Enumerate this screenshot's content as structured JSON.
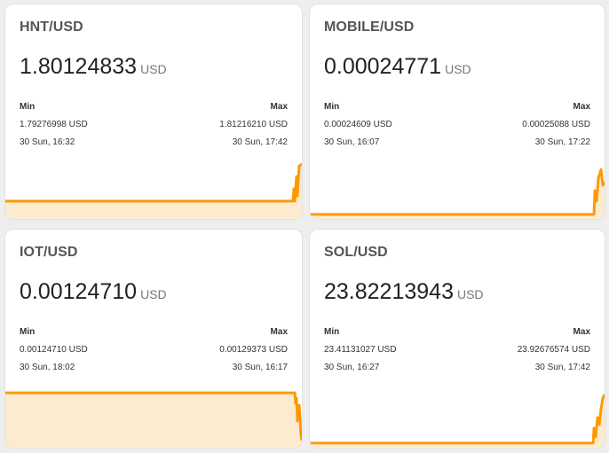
{
  "cards": [
    {
      "title": "HNT/USD",
      "value": "1.80124833",
      "unit": "USD",
      "min_label": "Min",
      "max_label": "Max",
      "min_value": "1.79276998 USD",
      "max_value": "1.81216210 USD",
      "min_time": "30 Sun, 16:32",
      "max_time": "30 Sun, 17:42"
    },
    {
      "title": "MOBILE/USD",
      "value": "0.00024771",
      "unit": "USD",
      "min_label": "Min",
      "max_label": "Max",
      "min_value": "0.00024609 USD",
      "max_value": "0.00025088 USD",
      "min_time": "30 Sun, 16:07",
      "max_time": "30 Sun, 17:22"
    },
    {
      "title": "IOT/USD",
      "value": "0.00124710",
      "unit": "USD",
      "min_label": "Min",
      "max_label": "Max",
      "min_value": "0.00124710 USD",
      "max_value": "0.00129373 USD",
      "min_time": "30 Sun, 18:02",
      "max_time": "30 Sun, 16:17"
    },
    {
      "title": "SOL/USD",
      "value": "23.82213943",
      "unit": "USD",
      "min_label": "Min",
      "max_label": "Max",
      "min_value": "23.41131027 USD",
      "max_value": "23.92676574 USD",
      "min_time": "30 Sun, 16:27",
      "max_time": "30 Sun, 17:42"
    }
  ],
  "colors": {
    "line": "#ff9800",
    "fill": "#fdebd0",
    "card_bg": "#ffffff",
    "page_bg": "#eeeeee"
  }
}
